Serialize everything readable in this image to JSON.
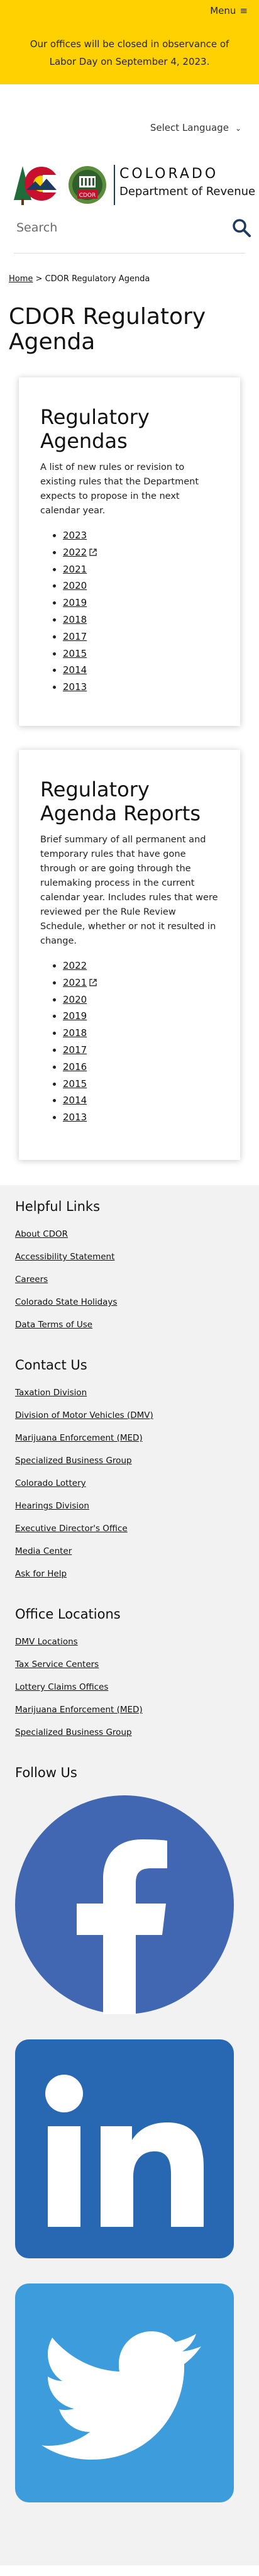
{
  "header": {
    "menu_label": "Menu",
    "alert_text": "Our offices will be closed in observance of Labor Day on September 4, 2023.",
    "language_select": "Select Language",
    "brand_name": "COLORADO",
    "brand_department": "Department of Revenue",
    "logo_badge_text": "CDOR",
    "search_placeholder": "Search",
    "colors": {
      "accent_yellow": "#ffd100",
      "navy": "#1e3a5f"
    }
  },
  "breadcrumb": {
    "home": "Home",
    "separator": ">",
    "current": "CDOR Regulatory Agenda"
  },
  "page_title": "CDOR Regulatory Agenda",
  "agendas": {
    "title": "Regulatory Agendas",
    "description": "A list of new rules or revision to existing rules that the Department expects to propose in the next calendar year.",
    "years": [
      {
        "label": "2023",
        "external": false
      },
      {
        "label": "2022",
        "external": true
      },
      {
        "label": "2021",
        "external": false
      },
      {
        "label": "2020",
        "external": false
      },
      {
        "label": "2019",
        "external": false
      },
      {
        "label": "2018",
        "external": false
      },
      {
        "label": "2017",
        "external": false
      },
      {
        "label": "2015",
        "external": false
      },
      {
        "label": "2014",
        "external": false
      },
      {
        "label": "2013",
        "external": false
      }
    ]
  },
  "reports": {
    "title": "Regulatory Agenda Reports",
    "description": "Brief summary of all permanent and temporary rules that have gone through or are going through the rulemaking process in the current calendar year. Includes rules that were reviewed per the Rule Review Schedule, whether or not it resulted in change.",
    "years": [
      {
        "label": "2022",
        "external": false
      },
      {
        "label": "2021",
        "external": true
      },
      {
        "label": "2020",
        "external": false
      },
      {
        "label": "2019",
        "external": false
      },
      {
        "label": "2018",
        "external": false
      },
      {
        "label": "2017",
        "external": false
      },
      {
        "label": "2016",
        "external": false
      },
      {
        "label": "2015",
        "external": false
      },
      {
        "label": "2014",
        "external": false
      },
      {
        "label": "2013",
        "external": false
      }
    ]
  },
  "footer": {
    "helpful_links": {
      "title": "Helpful Links",
      "items": [
        "About CDOR",
        "Accessibility Statement",
        "Careers",
        "Colorado State Holidays",
        "Data Terms of Use"
      ]
    },
    "contact_us": {
      "title": "Contact Us",
      "items": [
        "Taxation Division",
        "Division of Motor Vehicles (DMV)",
        "Marijuana Enforcement (MED)",
        "Specialized Business Group",
        "Colorado Lottery",
        "Hearings Division",
        "Executive Director's Office",
        "Media Center",
        "Ask for Help"
      ]
    },
    "office_locations": {
      "title": "Office Locations",
      "items": [
        "DMV Locations",
        "Tax Service Centers",
        "Lottery Claims Offices",
        "Marijuana Enforcement (MED)",
        "Specialized Business Group"
      ]
    },
    "follow_us": {
      "title": "Follow Us",
      "networks": [
        {
          "icon": "facebook-icon",
          "color": "#4267b2"
        },
        {
          "icon": "linkedin-icon",
          "color": "#2867b2"
        },
        {
          "icon": "twitter-icon",
          "color": "#3d9ddc"
        }
      ]
    }
  }
}
